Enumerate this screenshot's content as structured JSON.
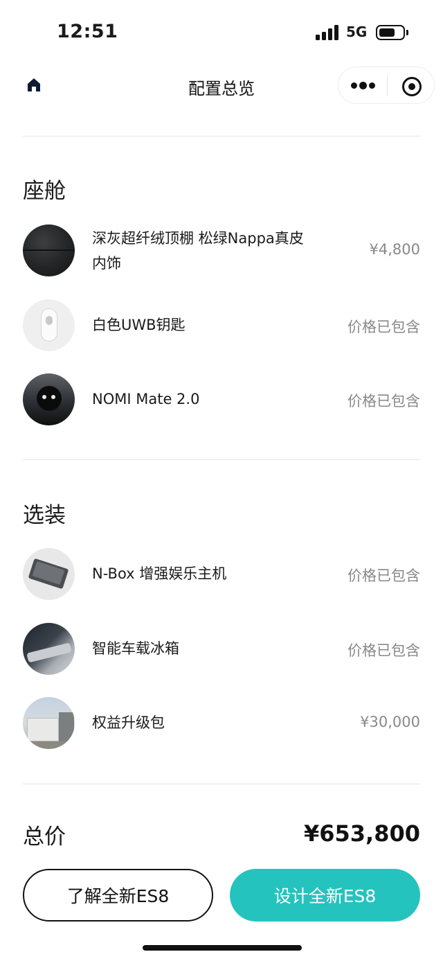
{
  "status_bar": {
    "time": "12:51",
    "network": "5G"
  },
  "nav": {
    "title": "配置总览"
  },
  "sections": [
    {
      "title": "座舱",
      "items": [
        {
          "name_line1": "深灰超纤绒顶棚 松绿Nappa真皮",
          "name_line2": "内饰",
          "price": "¥4,800"
        },
        {
          "name": "白色UWB钥匙",
          "price": "价格已包含"
        },
        {
          "name": "NOMI Mate 2.0",
          "price": "价格已包含"
        }
      ]
    },
    {
      "title": "选装",
      "items": [
        {
          "name": "N-Box 增强娱乐主机",
          "price": "价格已包含"
        },
        {
          "name": "智能车载冰箱",
          "price": "价格已包含"
        },
        {
          "name": "权益升级包",
          "price": "¥30,000"
        }
      ]
    }
  ],
  "total": {
    "label": "总价",
    "value": "¥653,800"
  },
  "actions": {
    "learn_label": "了解全新ES8",
    "design_label": "设计全新ES8"
  },
  "colors": {
    "accent": "#25c3bd",
    "text": "#1a1a1a",
    "muted": "#888888"
  }
}
